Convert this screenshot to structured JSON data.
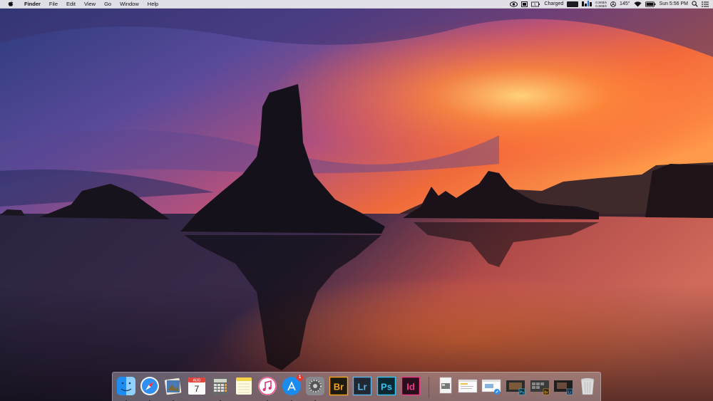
{
  "menubar": {
    "app_name": "Finder",
    "menus": [
      "File",
      "Edit",
      "View",
      "Go",
      "Window",
      "Help"
    ],
    "status": {
      "battery_label": "Charged",
      "net_up": "0.3KB/s",
      "net_down": "0.3KB/s",
      "temperature": "145°",
      "clock": "Sun 5:56 PM"
    }
  },
  "dock": {
    "calendar_month": "AUG",
    "calendar_day": "7",
    "appstore_badge": "1",
    "bridge_label": "Br",
    "lightroom_label": "Lr",
    "photoshop_label": "Ps",
    "indesign_label": "Id",
    "mini_ps_label": "Ps",
    "mini_br_label": "Br",
    "mini_lr_label": "Lr"
  },
  "colors": {
    "bridge": "#f2a21b",
    "lightroom": "#59b5e8",
    "photoshop": "#31c5f0",
    "indesign": "#f0378a",
    "adobe_bg": "#1f2833",
    "badge": "#e8372e"
  }
}
